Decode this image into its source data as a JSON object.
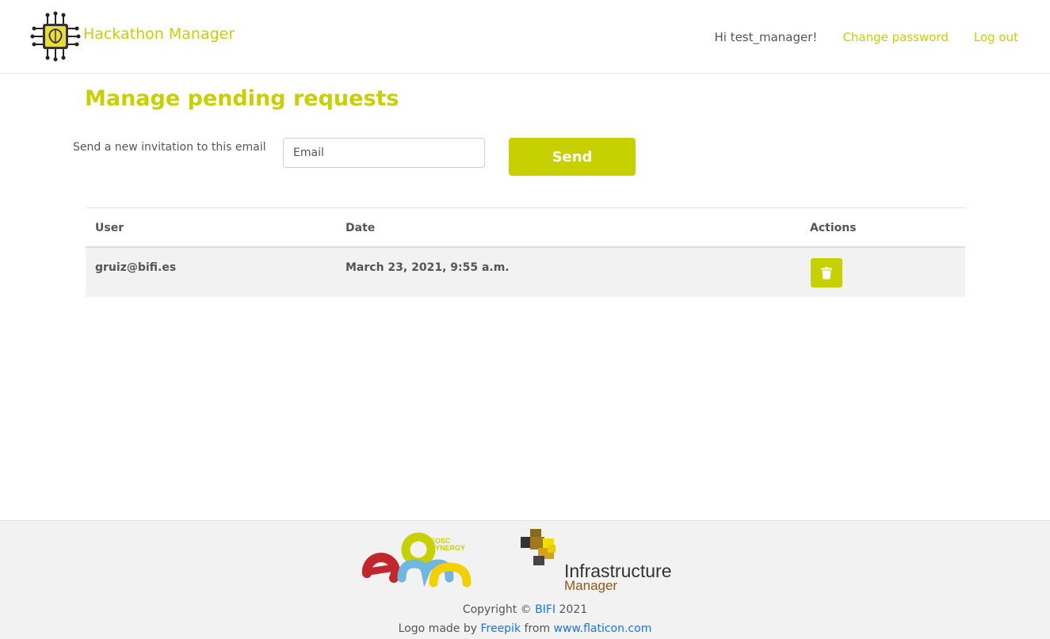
{
  "app": {
    "title": "Hackathon Manager",
    "brand_icon": "circuit-brain-icon",
    "accent_color": "#c7d000"
  },
  "nav": {
    "greeting": "Hi test_manager!",
    "change_password": "Change password",
    "logout": "Log out"
  },
  "page": {
    "title": "Manage pending requests"
  },
  "invite": {
    "label": "Send a new invitation to this email",
    "placeholder": "Email",
    "value": "",
    "send_label": "Send"
  },
  "table": {
    "headers": {
      "user": "User",
      "date": "Date",
      "actions": "Actions"
    },
    "rows": [
      {
        "user": "gruiz@bifi.es",
        "date": "March 23, 2021, 9:55 a.m.",
        "action_icon": "trash-icon"
      }
    ]
  },
  "footer": {
    "eosc_line1": "EOSC",
    "eosc_line2": "SYNERGY",
    "im_title": "Infrastructure",
    "im_sub": "Manager",
    "copyright_prefix": "Copyright © ",
    "copyright_link": "BIFI",
    "copyright_suffix": " 2021",
    "logo_prefix": "Logo made by ",
    "logo_link1": "Freepik",
    "logo_mid": " from ",
    "logo_link2": "www.flaticon.com",
    "link_color": "#1a73e8"
  }
}
